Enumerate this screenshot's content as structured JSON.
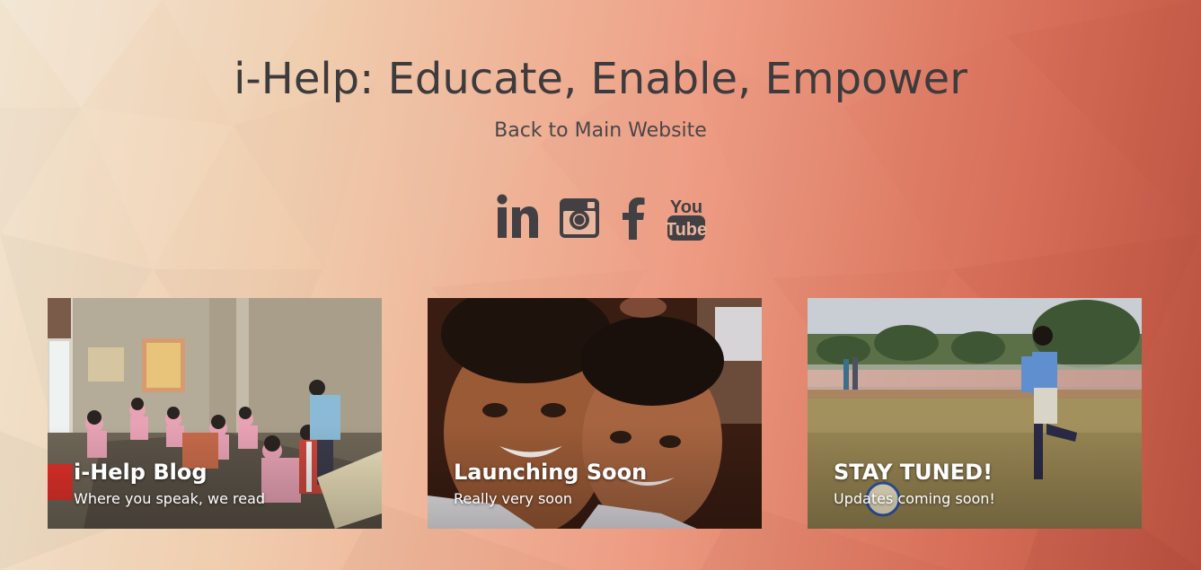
{
  "header": {
    "title": "i-Help: Educate, Enable, Empower",
    "back_link": "Back to Main Website"
  },
  "social": [
    {
      "icon": "linkedin-icon"
    },
    {
      "icon": "instagram-icon"
    },
    {
      "icon": "facebook-icon"
    },
    {
      "icon": "youtube-icon",
      "text_top": "You",
      "text_bottom": "Tube"
    }
  ],
  "cards": [
    {
      "title": "i-Help Blog",
      "subtitle": "Where you speak, we read"
    },
    {
      "title": "Launching Soon",
      "subtitle": "Really very soon"
    },
    {
      "title": "STAY TUNED!",
      "subtitle": "Updates coming soon!"
    }
  ],
  "colors": {
    "text_dark": "#3e3b3d",
    "icon": "#424042",
    "caption": "#ffffff"
  }
}
